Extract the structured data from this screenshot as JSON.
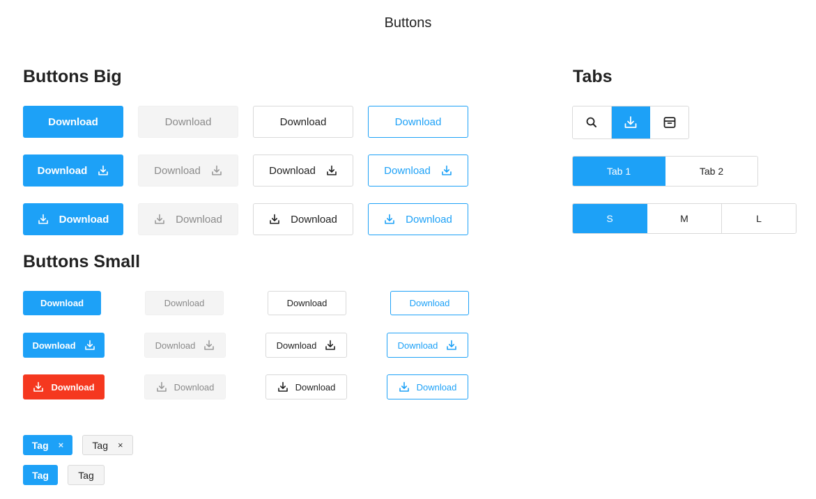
{
  "page": {
    "title": "Buttons"
  },
  "sections": {
    "big": "Buttons Big",
    "small": "Buttons Small",
    "tabs": "Tabs"
  },
  "button": {
    "label": "Download"
  },
  "tabs": {
    "icon_tabs": [
      "search-icon",
      "download-icon",
      "archive-icon"
    ],
    "icon_active": 1,
    "text_tabs": [
      "Tab 1",
      "Tab 2"
    ],
    "text_active": 0,
    "size_tabs": [
      "S",
      "M",
      "L"
    ],
    "size_active": 0
  },
  "tags": {
    "label": "Tag",
    "close": "×"
  },
  "colors": {
    "primary": "#1da1f7",
    "danger": "#f5381f",
    "disabled_bg": "#f4f4f4",
    "border": "#d9d9d9"
  }
}
